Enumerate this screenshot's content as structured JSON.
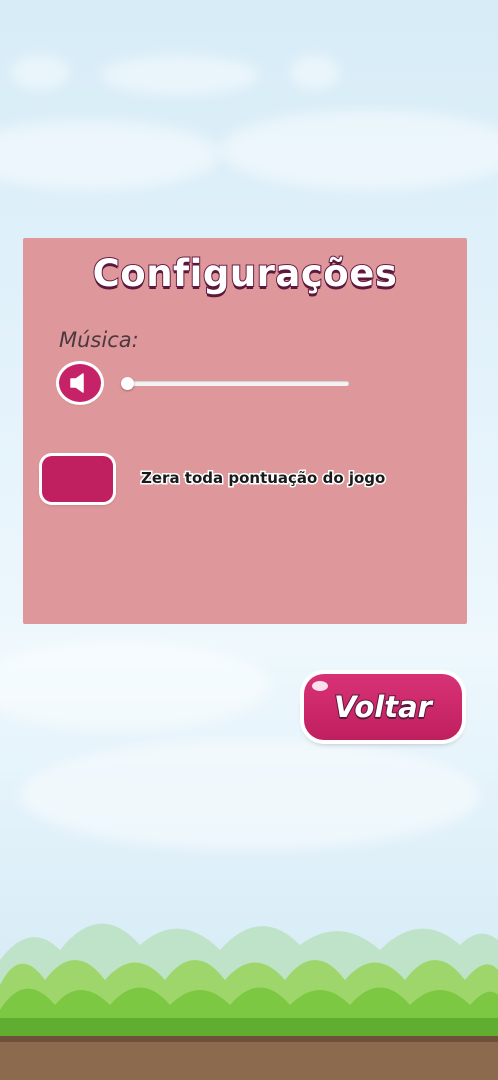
{
  "settings_panel": {
    "title": "Configurações",
    "music_label": "Música:",
    "music_volume": 0.0,
    "reset_description": "Zera toda pontuação do jogo"
  },
  "back_button": {
    "label": "Voltar"
  },
  "icons": {
    "speaker": "speaker-icon"
  },
  "colors": {
    "accent": "#c62267",
    "panel": "#de979a",
    "sky": "#e3f2fb",
    "grass": "#7cc843"
  }
}
